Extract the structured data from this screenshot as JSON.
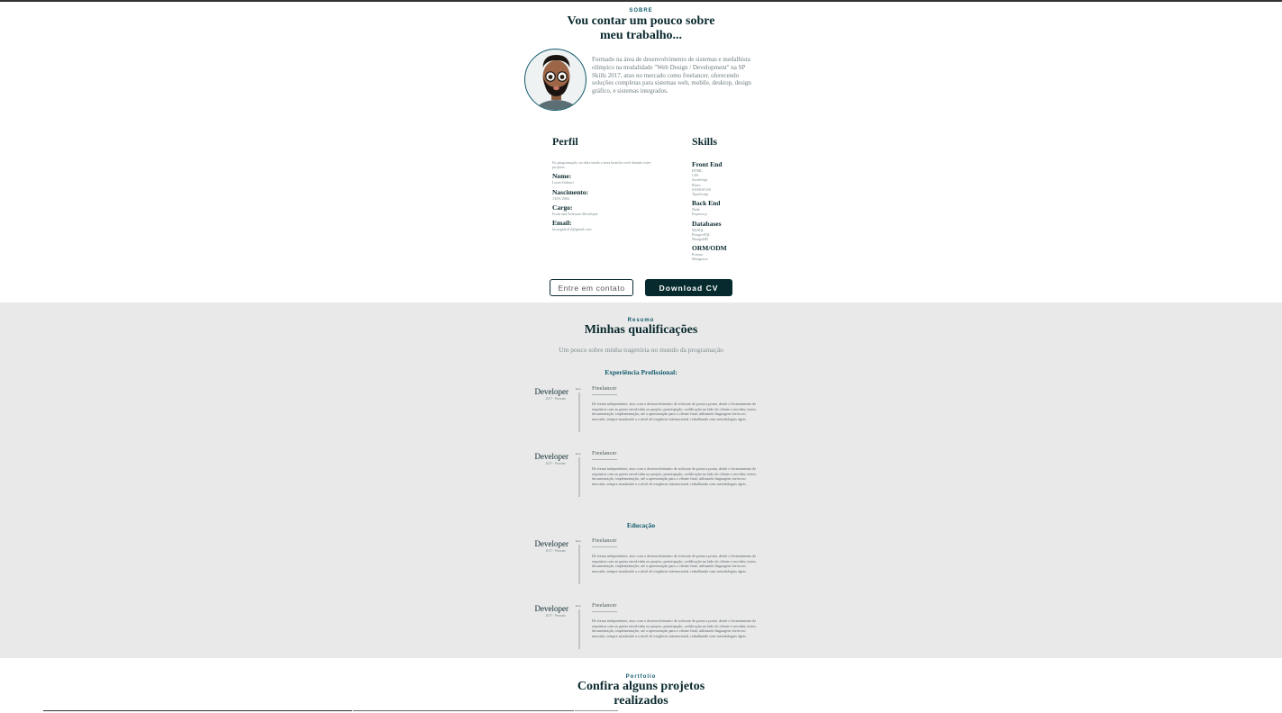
{
  "about": {
    "eyebrow": "SOBRE",
    "title_line1": "Vou contar um pouco sobre",
    "title_line2": "meu trabalho...",
    "intro": "Formado na área de desenvolvimento de sistemas e medalhista olímpico na modalidade \"Web Design / Development\" na SP Skills 2017, atuo no mercado como freelancer, oferecendo soluções completas para sistemas web, mobile, desktop, design gráfico, e sistemas integrados."
  },
  "profile": {
    "title": "Perfil",
    "blurb": "Eu programação, eu diria tendo a terra brasilia você durante estes projetos.",
    "fields": [
      {
        "label": "Nome:",
        "value": "Lucas Imbraci"
      },
      {
        "label": "Nascimento:",
        "value": "13/01/2002"
      },
      {
        "label": "Cargo:",
        "value": "Front and Software Developer"
      },
      {
        "label": "Email:",
        "value": "lucasgusto12@gmail.com"
      }
    ]
  },
  "skills": {
    "title": "Skills",
    "groups": [
      {
        "name": "Front End",
        "items": [
          "HTML",
          "CSS",
          "JavaScript",
          "React",
          "SASS/SCSS",
          "TypeScript"
        ]
      },
      {
        "name": "Back End",
        "items": [
          "Node",
          "Express.js"
        ]
      },
      {
        "name": "Databases",
        "items": [
          "MySQL",
          "PostgreSQL",
          "MongoDB"
        ]
      },
      {
        "name": "ORM/ODM",
        "items": [
          "Prisma",
          "Mongoose"
        ]
      }
    ]
  },
  "buttons": {
    "contact": "Entre em contato",
    "download": "Download CV"
  },
  "qualifications": {
    "eyebrow": "Resumo",
    "title": "Minhas qualificações",
    "subtitle": "Um pouco sobre minha tragetória no mundo da programação",
    "experience_head": "Experiência Profissional:",
    "education_head": "Educação",
    "entry": {
      "role": "Developer",
      "period": "2017 - Presente",
      "icon_tag": "icon",
      "company": "Freelancer",
      "desc": "De forma independente, atuo com o desenvolvimento de software de ponta a ponta, desde o levantamento de requisitos com as partes envolvidas no projeto, prototipação, codificação no lado do cliente e servidor, testes, documentação, implementação, até a apresentação para o cliente final, utilizando linguagens fortes no mercado, sempre atualizado a o nível de exigência internacional, trabalhando com metodologias ágeis."
    }
  },
  "portfolio": {
    "eyebrow": "Portfolio",
    "title_line1": "Confira alguns projetos",
    "title_line2": "realizados"
  }
}
